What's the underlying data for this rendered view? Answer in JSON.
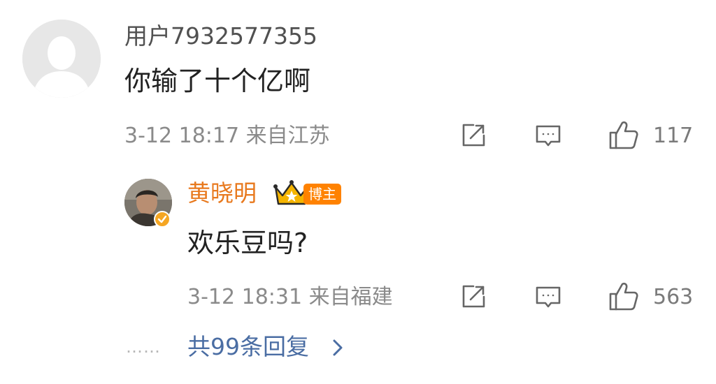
{
  "comment": {
    "username": "用户7932577355",
    "text": "你输了十个亿啊",
    "meta": "3-12 18:17 来自江苏",
    "likes": "117"
  },
  "reply": {
    "username": "黄晓明",
    "badge": "博主",
    "text": "欢乐豆吗?",
    "meta": "3-12 18:31 来自福建",
    "likes": "563"
  },
  "more_replies": {
    "dots": "……",
    "label": "共99条回复"
  },
  "colors": {
    "accent_orange": "#ff8200",
    "name_orange": "#e8791e",
    "link_blue": "#4a6da3",
    "meta_gray": "#8a8a8a"
  },
  "icons": [
    "share-icon",
    "comment-icon",
    "like-icon",
    "crown-icon",
    "verified-icon",
    "chevron-right-icon"
  ]
}
